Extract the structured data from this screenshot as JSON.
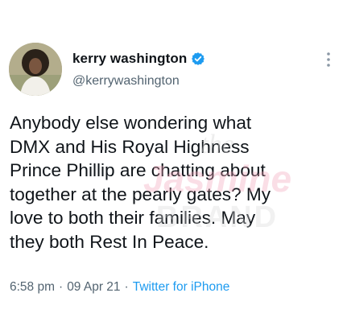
{
  "tweet": {
    "author_name": "kerry washington",
    "author_handle": "@kerrywashington",
    "body": "Anybody else wondering what\nDMX and His Royal Highness\nPrince Phillip are chatting about\ntogether at the pearly gates? My\nlove to both their families. May\nthey both Rest In Peace.",
    "time": "6:58 pm",
    "date": "09 Apr 21",
    "source": "Twitter for iPhone",
    "separator": "·"
  },
  "icons": {
    "verified": "verified-badge-icon",
    "more": "more-vertical-icon"
  },
  "colors": {
    "accent": "#1d9bf0",
    "text": "#0f1419",
    "secondary": "#536471"
  }
}
